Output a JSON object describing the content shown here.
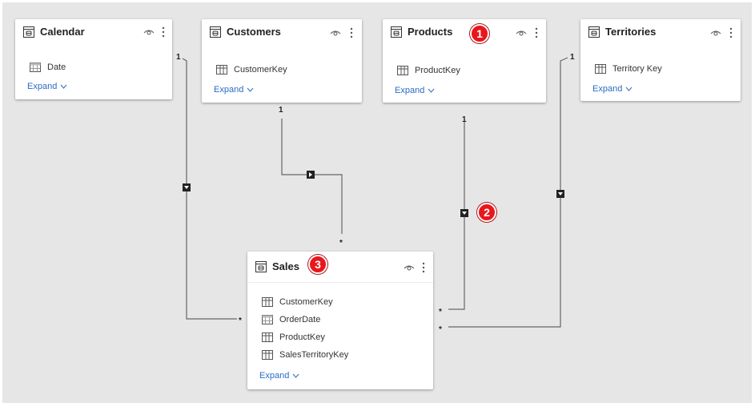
{
  "tables": {
    "calendar": {
      "title": "Calendar",
      "fields": [
        "Date"
      ],
      "expand": "Expand"
    },
    "customers": {
      "title": "Customers",
      "fields": [
        "CustomerKey"
      ],
      "expand": "Expand"
    },
    "products": {
      "title": "Products",
      "fields": [
        "ProductKey"
      ],
      "expand": "Expand"
    },
    "territories": {
      "title": "Territories",
      "fields": [
        "Territory Key"
      ],
      "expand": "Expand"
    },
    "sales": {
      "title": "Sales",
      "fields": [
        "CustomerKey",
        "OrderDate",
        "ProductKey",
        "SalesTerritoryKey"
      ],
      "expand": "Expand"
    }
  },
  "relationships": {
    "one": "1",
    "many": "*"
  },
  "badges": [
    "1",
    "2",
    "3"
  ],
  "colors": {
    "canvas": "#e6e6e6",
    "card": "#ffffff",
    "link": "#2b6cc4",
    "line": "#555555",
    "badge": "#e8171c"
  }
}
